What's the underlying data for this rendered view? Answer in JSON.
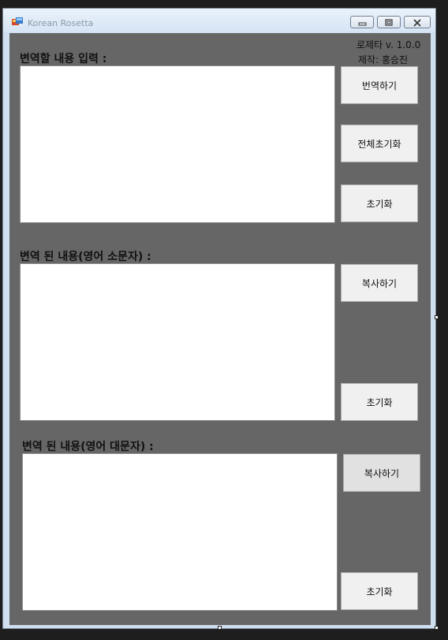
{
  "window": {
    "title": "Korean Rosetta",
    "icon": "app-window-icon",
    "controls": [
      "minimize-icon",
      "maximize-icon",
      "close-icon"
    ]
  },
  "header": {
    "version": "로제타 v. 1.0.0",
    "author": "제작:  홍승진"
  },
  "sections": {
    "input_label": "변역할 내용 입력 :",
    "lower_label": "변역 된 내용(영어 소문자) :",
    "upper_label": "변역 된 내용(영어 대문자) :"
  },
  "buttons": {
    "translate": "번역하기",
    "reset_all": "전체초기화",
    "reset_input": "초기화",
    "copy_lower": "복사하기",
    "reset_lower": "초기화",
    "copy_upper": "복사하기",
    "reset_upper": "초기화"
  },
  "fields": {
    "input_value": "",
    "lower_value": "",
    "upper_value": ""
  }
}
